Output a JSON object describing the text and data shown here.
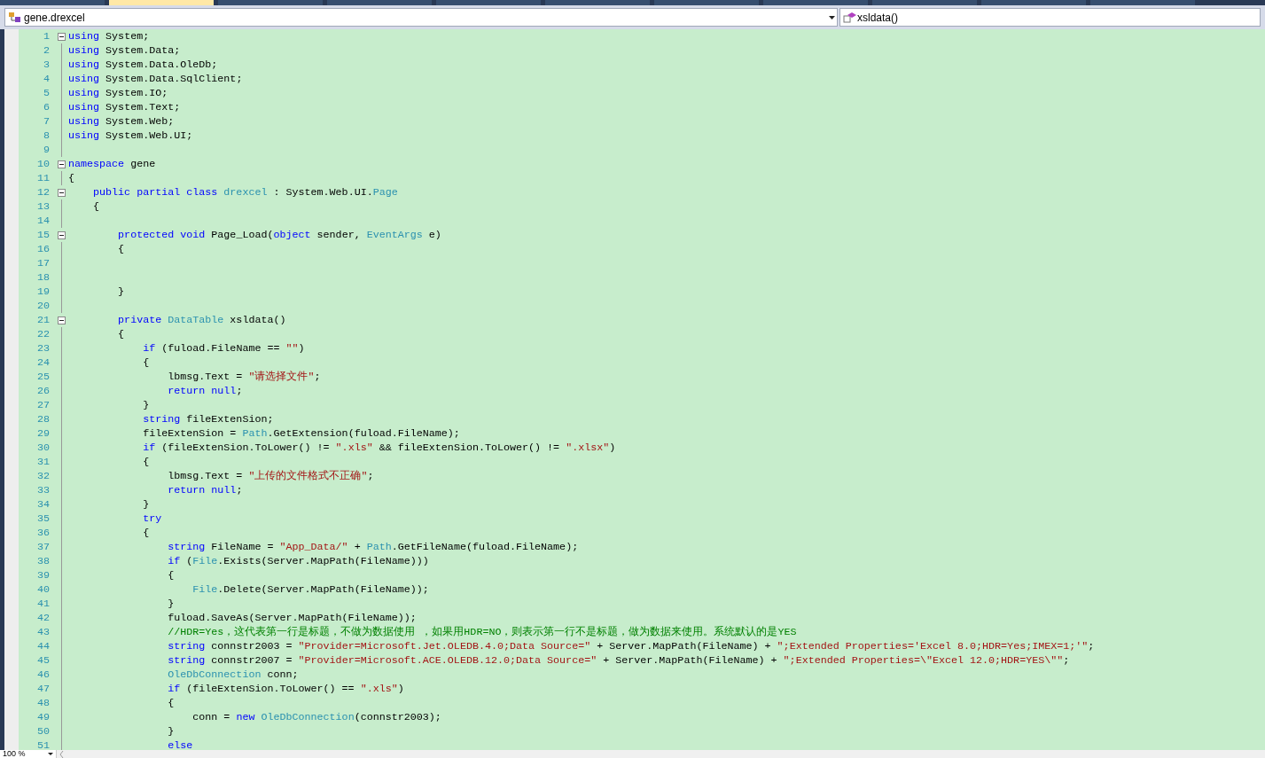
{
  "tabs": [
    {
      "selected": false
    },
    {
      "selected": true
    },
    {
      "selected": false
    },
    {
      "selected": false
    },
    {
      "selected": false
    },
    {
      "selected": false
    },
    {
      "selected": false
    },
    {
      "selected": false
    },
    {
      "selected": false
    },
    {
      "selected": false
    },
    {
      "selected": false
    }
  ],
  "navigation_bar": {
    "type_dropdown": "gene.drexcel",
    "member_dropdown": "xsldata()"
  },
  "editor": {
    "lines": [
      {
        "number": "1",
        "collapsible": true,
        "tokens": [
          {
            "kind": "kw",
            "text": "using"
          },
          {
            "kind": "plain",
            "text": " System;"
          }
        ]
      },
      {
        "number": "2",
        "collapsible": false,
        "tokens": [
          {
            "kind": "kw",
            "text": "using"
          },
          {
            "kind": "plain",
            "text": " System.Data;"
          }
        ]
      },
      {
        "number": "3",
        "collapsible": false,
        "tokens": [
          {
            "kind": "kw",
            "text": "using"
          },
          {
            "kind": "plain",
            "text": " System.Data.OleDb;"
          }
        ]
      },
      {
        "number": "4",
        "collapsible": false,
        "tokens": [
          {
            "kind": "kw",
            "text": "using"
          },
          {
            "kind": "plain",
            "text": " System.Data.SqlClient;"
          }
        ]
      },
      {
        "number": "5",
        "collapsible": false,
        "tokens": [
          {
            "kind": "kw",
            "text": "using"
          },
          {
            "kind": "plain",
            "text": " System.IO;"
          }
        ]
      },
      {
        "number": "6",
        "collapsible": false,
        "tokens": [
          {
            "kind": "kw",
            "text": "using"
          },
          {
            "kind": "plain",
            "text": " System.Text;"
          }
        ]
      },
      {
        "number": "7",
        "collapsible": false,
        "tokens": [
          {
            "kind": "kw",
            "text": "using"
          },
          {
            "kind": "plain",
            "text": " System.Web;"
          }
        ]
      },
      {
        "number": "8",
        "collapsible": false,
        "tokens": [
          {
            "kind": "kw",
            "text": "using"
          },
          {
            "kind": "plain",
            "text": " System.Web.UI;"
          }
        ]
      },
      {
        "number": "9",
        "collapsible": false
      },
      {
        "number": "10",
        "collapsible": true,
        "tokens": [
          {
            "kind": "kw",
            "text": "namespace"
          },
          {
            "kind": "plain",
            "text": " gene"
          }
        ]
      },
      {
        "number": "11",
        "collapsible": false,
        "tokens": [
          {
            "kind": "plain",
            "text": "{"
          }
        ]
      },
      {
        "number": "12",
        "collapsible": true,
        "tokens": [
          {
            "kind": "kw",
            "text": "    public partial class "
          },
          {
            "kind": "type",
            "text": "drexcel"
          },
          {
            "kind": "plain",
            "text": " : System.Web.UI."
          },
          {
            "kind": "type",
            "text": "Page"
          }
        ]
      },
      {
        "number": "13",
        "collapsible": false,
        "tokens": [
          {
            "kind": "plain",
            "text": "    {"
          }
        ]
      },
      {
        "number": "14",
        "collapsible": false
      },
      {
        "number": "15",
        "collapsible": true,
        "tokens": [
          {
            "kind": "kw",
            "text": "        protected void"
          },
          {
            "kind": "plain",
            "text": " Page_Load("
          },
          {
            "kind": "kw",
            "text": "object"
          },
          {
            "kind": "plain",
            "text": " sender, "
          },
          {
            "kind": "type",
            "text": "EventArgs"
          },
          {
            "kind": "plain",
            "text": " e)"
          }
        ]
      },
      {
        "number": "16",
        "collapsible": false,
        "tokens": [
          {
            "kind": "plain",
            "text": "        {"
          }
        ]
      },
      {
        "number": "17",
        "collapsible": false
      },
      {
        "number": "18",
        "collapsible": false
      },
      {
        "number": "19",
        "collapsible": false,
        "tokens": [
          {
            "kind": "plain",
            "text": "        }"
          }
        ]
      },
      {
        "number": "20",
        "collapsible": false
      },
      {
        "number": "21",
        "collapsible": true,
        "tokens": [
          {
            "kind": "kw",
            "text": "        private "
          },
          {
            "kind": "type",
            "text": "DataTable"
          },
          {
            "kind": "plain",
            "text": " xsldata()"
          }
        ]
      },
      {
        "number": "22",
        "collapsible": false,
        "tokens": [
          {
            "kind": "plain",
            "text": "        {"
          }
        ]
      },
      {
        "number": "23",
        "collapsible": false,
        "tokens": [
          {
            "kind": "kw",
            "text": "            if"
          },
          {
            "kind": "plain",
            "text": " (fuload.FileName == "
          },
          {
            "kind": "str",
            "text": "\"\""
          },
          {
            "kind": "plain",
            "text": ")"
          }
        ]
      },
      {
        "number": "24",
        "collapsible": false,
        "tokens": [
          {
            "kind": "plain",
            "text": "            {"
          }
        ]
      },
      {
        "number": "25",
        "collapsible": false,
        "tokens": [
          {
            "kind": "plain",
            "text": "                lbmsg.Text = "
          },
          {
            "kind": "str",
            "text": "\"请选择文件\""
          },
          {
            "kind": "plain",
            "text": ";"
          }
        ]
      },
      {
        "number": "26",
        "collapsible": false,
        "tokens": [
          {
            "kind": "kw",
            "text": "                return null"
          },
          {
            "kind": "plain",
            "text": ";"
          }
        ]
      },
      {
        "number": "27",
        "collapsible": false,
        "tokens": [
          {
            "kind": "plain",
            "text": "            }"
          }
        ]
      },
      {
        "number": "28",
        "collapsible": false,
        "tokens": [
          {
            "kind": "kw",
            "text": "            string"
          },
          {
            "kind": "plain",
            "text": " fileExtenSion;"
          }
        ]
      },
      {
        "number": "29",
        "collapsible": false,
        "tokens": [
          {
            "kind": "plain",
            "text": "            fileExtenSion = "
          },
          {
            "kind": "type",
            "text": "Path"
          },
          {
            "kind": "plain",
            "text": ".GetExtension(fuload.FileName);"
          }
        ]
      },
      {
        "number": "30",
        "collapsible": false,
        "tokens": [
          {
            "kind": "kw",
            "text": "            if"
          },
          {
            "kind": "plain",
            "text": " (fileExtenSion.ToLower() != "
          },
          {
            "kind": "str",
            "text": "\".xls\""
          },
          {
            "kind": "plain",
            "text": " && fileExtenSion.ToLower() != "
          },
          {
            "kind": "str",
            "text": "\".xlsx\""
          },
          {
            "kind": "plain",
            "text": ")"
          }
        ]
      },
      {
        "number": "31",
        "collapsible": false,
        "tokens": [
          {
            "kind": "plain",
            "text": "            {"
          }
        ]
      },
      {
        "number": "32",
        "collapsible": false,
        "tokens": [
          {
            "kind": "plain",
            "text": "                lbmsg.Text = "
          },
          {
            "kind": "str",
            "text": "\"上传的文件格式不正确\""
          },
          {
            "kind": "plain",
            "text": ";"
          }
        ]
      },
      {
        "number": "33",
        "collapsible": false,
        "tokens": [
          {
            "kind": "kw",
            "text": "                return null"
          },
          {
            "kind": "plain",
            "text": ";"
          }
        ]
      },
      {
        "number": "34",
        "collapsible": false,
        "tokens": [
          {
            "kind": "plain",
            "text": "            }"
          }
        ]
      },
      {
        "number": "35",
        "collapsible": false,
        "tokens": [
          {
            "kind": "kw",
            "text": "            try"
          }
        ]
      },
      {
        "number": "36",
        "collapsible": false,
        "tokens": [
          {
            "kind": "plain",
            "text": "            {"
          }
        ]
      },
      {
        "number": "37",
        "collapsible": false,
        "tokens": [
          {
            "kind": "kw",
            "text": "                string"
          },
          {
            "kind": "plain",
            "text": " FileName = "
          },
          {
            "kind": "str",
            "text": "\"App_Data/\""
          },
          {
            "kind": "plain",
            "text": " + "
          },
          {
            "kind": "type",
            "text": "Path"
          },
          {
            "kind": "plain",
            "text": ".GetFileName(fuload.FileName);"
          }
        ]
      },
      {
        "number": "38",
        "collapsible": false,
        "tokens": [
          {
            "kind": "kw",
            "text": "                if"
          },
          {
            "kind": "plain",
            "text": " ("
          },
          {
            "kind": "type",
            "text": "File"
          },
          {
            "kind": "plain",
            "text": ".Exists(Server.MapPath(FileName)))"
          }
        ]
      },
      {
        "number": "39",
        "collapsible": false,
        "tokens": [
          {
            "kind": "plain",
            "text": "                {"
          }
        ]
      },
      {
        "number": "40",
        "collapsible": false,
        "tokens": [
          {
            "kind": "type",
            "text": "                    File"
          },
          {
            "kind": "plain",
            "text": ".Delete(Server.MapPath(FileName));"
          }
        ]
      },
      {
        "number": "41",
        "collapsible": false,
        "tokens": [
          {
            "kind": "plain",
            "text": "                }"
          }
        ]
      },
      {
        "number": "42",
        "collapsible": false,
        "tokens": [
          {
            "kind": "plain",
            "text": "                fuload.SaveAs(Server.MapPath(FileName));"
          }
        ]
      },
      {
        "number": "43",
        "collapsible": false,
        "tokens": [
          {
            "kind": "comment",
            "text": "                //HDR=Yes，这代表第一行是标题，不做为数据使用 ，如果用HDR=NO，则表示第一行不是标题，做为数据来使用。系统默认的是YES"
          }
        ]
      },
      {
        "number": "44",
        "collapsible": false,
        "tokens": [
          {
            "kind": "kw",
            "text": "                string"
          },
          {
            "kind": "plain",
            "text": " connstr2003 = "
          },
          {
            "kind": "str",
            "text": "\"Provider=Microsoft.Jet.OLEDB.4.0;Data Source=\""
          },
          {
            "kind": "plain",
            "text": " + Server.MapPath(FileName) + "
          },
          {
            "kind": "str",
            "text": "\";Extended Properties='Excel 8.0;HDR=Yes;IMEX=1;'\""
          },
          {
            "kind": "plain",
            "text": ";"
          }
        ]
      },
      {
        "number": "45",
        "collapsible": false,
        "tokens": [
          {
            "kind": "kw",
            "text": "                string"
          },
          {
            "kind": "plain",
            "text": " connstr2007 = "
          },
          {
            "kind": "str",
            "text": "\"Provider=Microsoft.ACE.OLEDB.12.0;Data Source=\""
          },
          {
            "kind": "plain",
            "text": " + Server.MapPath(FileName) + "
          },
          {
            "kind": "str",
            "text": "\";Extended Properties=\\\"Excel 12.0;HDR=YES\\\"\""
          },
          {
            "kind": "plain",
            "text": ";"
          }
        ]
      },
      {
        "number": "46",
        "collapsible": false,
        "tokens": [
          {
            "kind": "type",
            "text": "                OleDbConnection"
          },
          {
            "kind": "plain",
            "text": " conn;"
          }
        ]
      },
      {
        "number": "47",
        "collapsible": false,
        "tokens": [
          {
            "kind": "kw",
            "text": "                if"
          },
          {
            "kind": "plain",
            "text": " (fileExtenSion.ToLower() == "
          },
          {
            "kind": "str",
            "text": "\".xls\""
          },
          {
            "kind": "plain",
            "text": ")"
          }
        ]
      },
      {
        "number": "48",
        "collapsible": false,
        "tokens": [
          {
            "kind": "plain",
            "text": "                {"
          }
        ]
      },
      {
        "number": "49",
        "collapsible": false,
        "tokens": [
          {
            "kind": "plain",
            "text": "                    conn = "
          },
          {
            "kind": "kw",
            "text": "new "
          },
          {
            "kind": "type",
            "text": "OleDbConnection"
          },
          {
            "kind": "plain",
            "text": "(connstr2003);"
          }
        ]
      },
      {
        "number": "50",
        "collapsible": false,
        "tokens": [
          {
            "kind": "plain",
            "text": "                }"
          }
        ]
      },
      {
        "number": "51",
        "collapsible": false,
        "tokens": [
          {
            "kind": "kw",
            "text": "                else"
          }
        ]
      }
    ]
  },
  "status_bar": {
    "zoom": "100 %"
  }
}
